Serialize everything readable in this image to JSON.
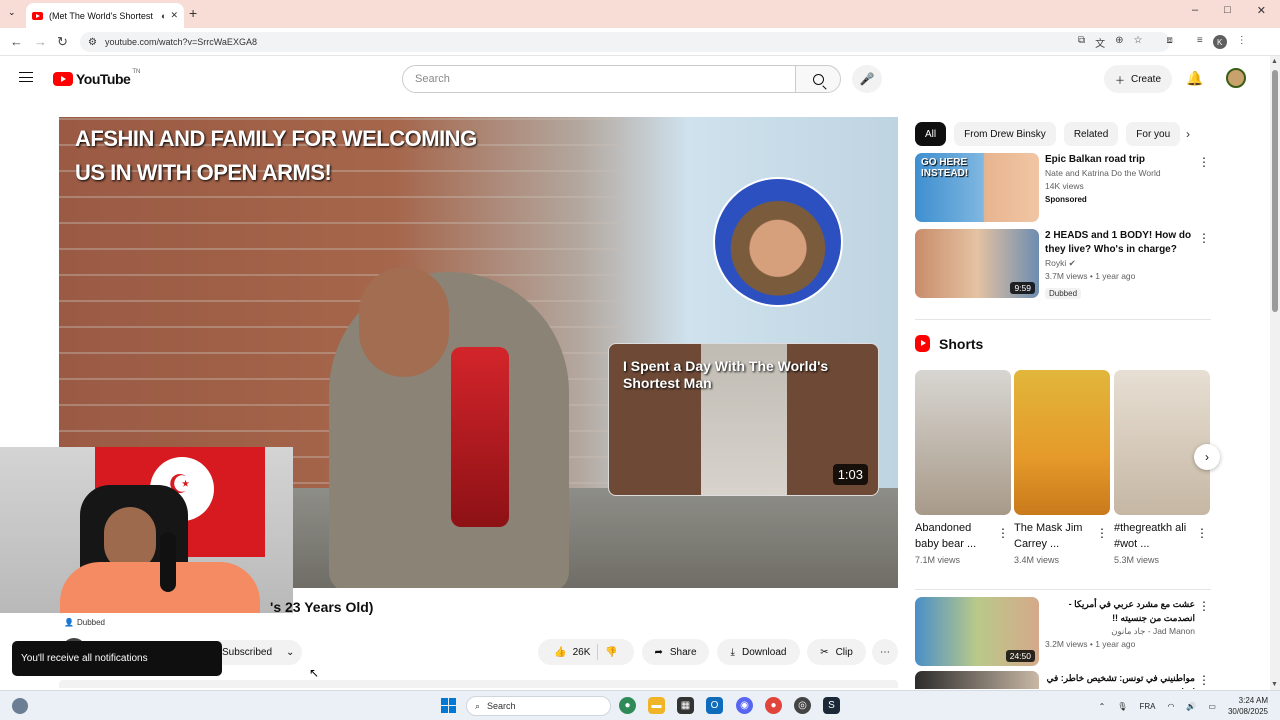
{
  "browser": {
    "tab_title": "(Met The World's Shortest",
    "url": "youtube.com/watch?v=SrrcWaEXGA8",
    "profile_initial": "K",
    "new_tab_label": "+",
    "window_controls": [
      "–",
      "□",
      "✕"
    ]
  },
  "header": {
    "logo_text": "YouTube",
    "logo_suffix": "TN",
    "search_placeholder": "Search",
    "create_label": "Create"
  },
  "player": {
    "overlay_title_line1": "AFSHIN AND FAMILY FOR WELCOMING",
    "overlay_title_line2": "US IN WITH OPEN ARMS!",
    "endcard_title": "I Spent a Day With The World's Shortest Man",
    "endcard_duration": "1:03"
  },
  "video": {
    "title_fragment": "'s 23 Years Old)",
    "dubbed_label": "Dubbed",
    "subscribed_label": "Subscribed",
    "likes": "26K",
    "share_label": "Share",
    "download_label": "Download",
    "clip_label": "Clip",
    "more_label": "⋯"
  },
  "toast": {
    "message": "You'll receive all notifications"
  },
  "chips": [
    "All",
    "From Drew Binsky",
    "Related",
    "For you"
  ],
  "recommendations": [
    {
      "title": "Epic Balkan road trip",
      "channel": "Nate and Katrina Do the World",
      "views": "14K views",
      "badge": "Sponsored",
      "thumb_text": "GO HERE INSTEAD!"
    },
    {
      "title": "2 HEADS and 1 BODY! How do they live? Who's in charge?",
      "channel": "Royki",
      "views": "3.7M views • 1 year ago",
      "tag": "Dubbed",
      "duration": "9:59"
    }
  ],
  "shorts": {
    "heading": "Shorts",
    "items": [
      {
        "title": "Abandoned baby bear ...",
        "views": "7.1M views"
      },
      {
        "title": "The Mask Jim Carrey ...",
        "views": "3.4M views"
      },
      {
        "title": "#thegreatkh ali #wot ...",
        "views": "5.3M views"
      }
    ]
  },
  "more_recommendations": [
    {
      "title": "عشت مع مشرد عربي في أمريكا - انصدمت من جنسيته !!",
      "channel": "Jad Manon - جاد مانون",
      "views": "3.2M views • 1 year ago",
      "duration": "24:50"
    },
    {
      "title": "مواطنيني في تونس: تشخيص خاطر: في ليبيا"
    }
  ],
  "taskbar": {
    "search_label": "Search",
    "language": "FRA",
    "time": "3:24 AM",
    "date": "30/08/2025"
  },
  "colors": {
    "youtube_red": "#ff0000",
    "tab_strip": "#f8dcd6",
    "chip_active": "#0f0f0f",
    "windows_blue": "#0078d4"
  }
}
